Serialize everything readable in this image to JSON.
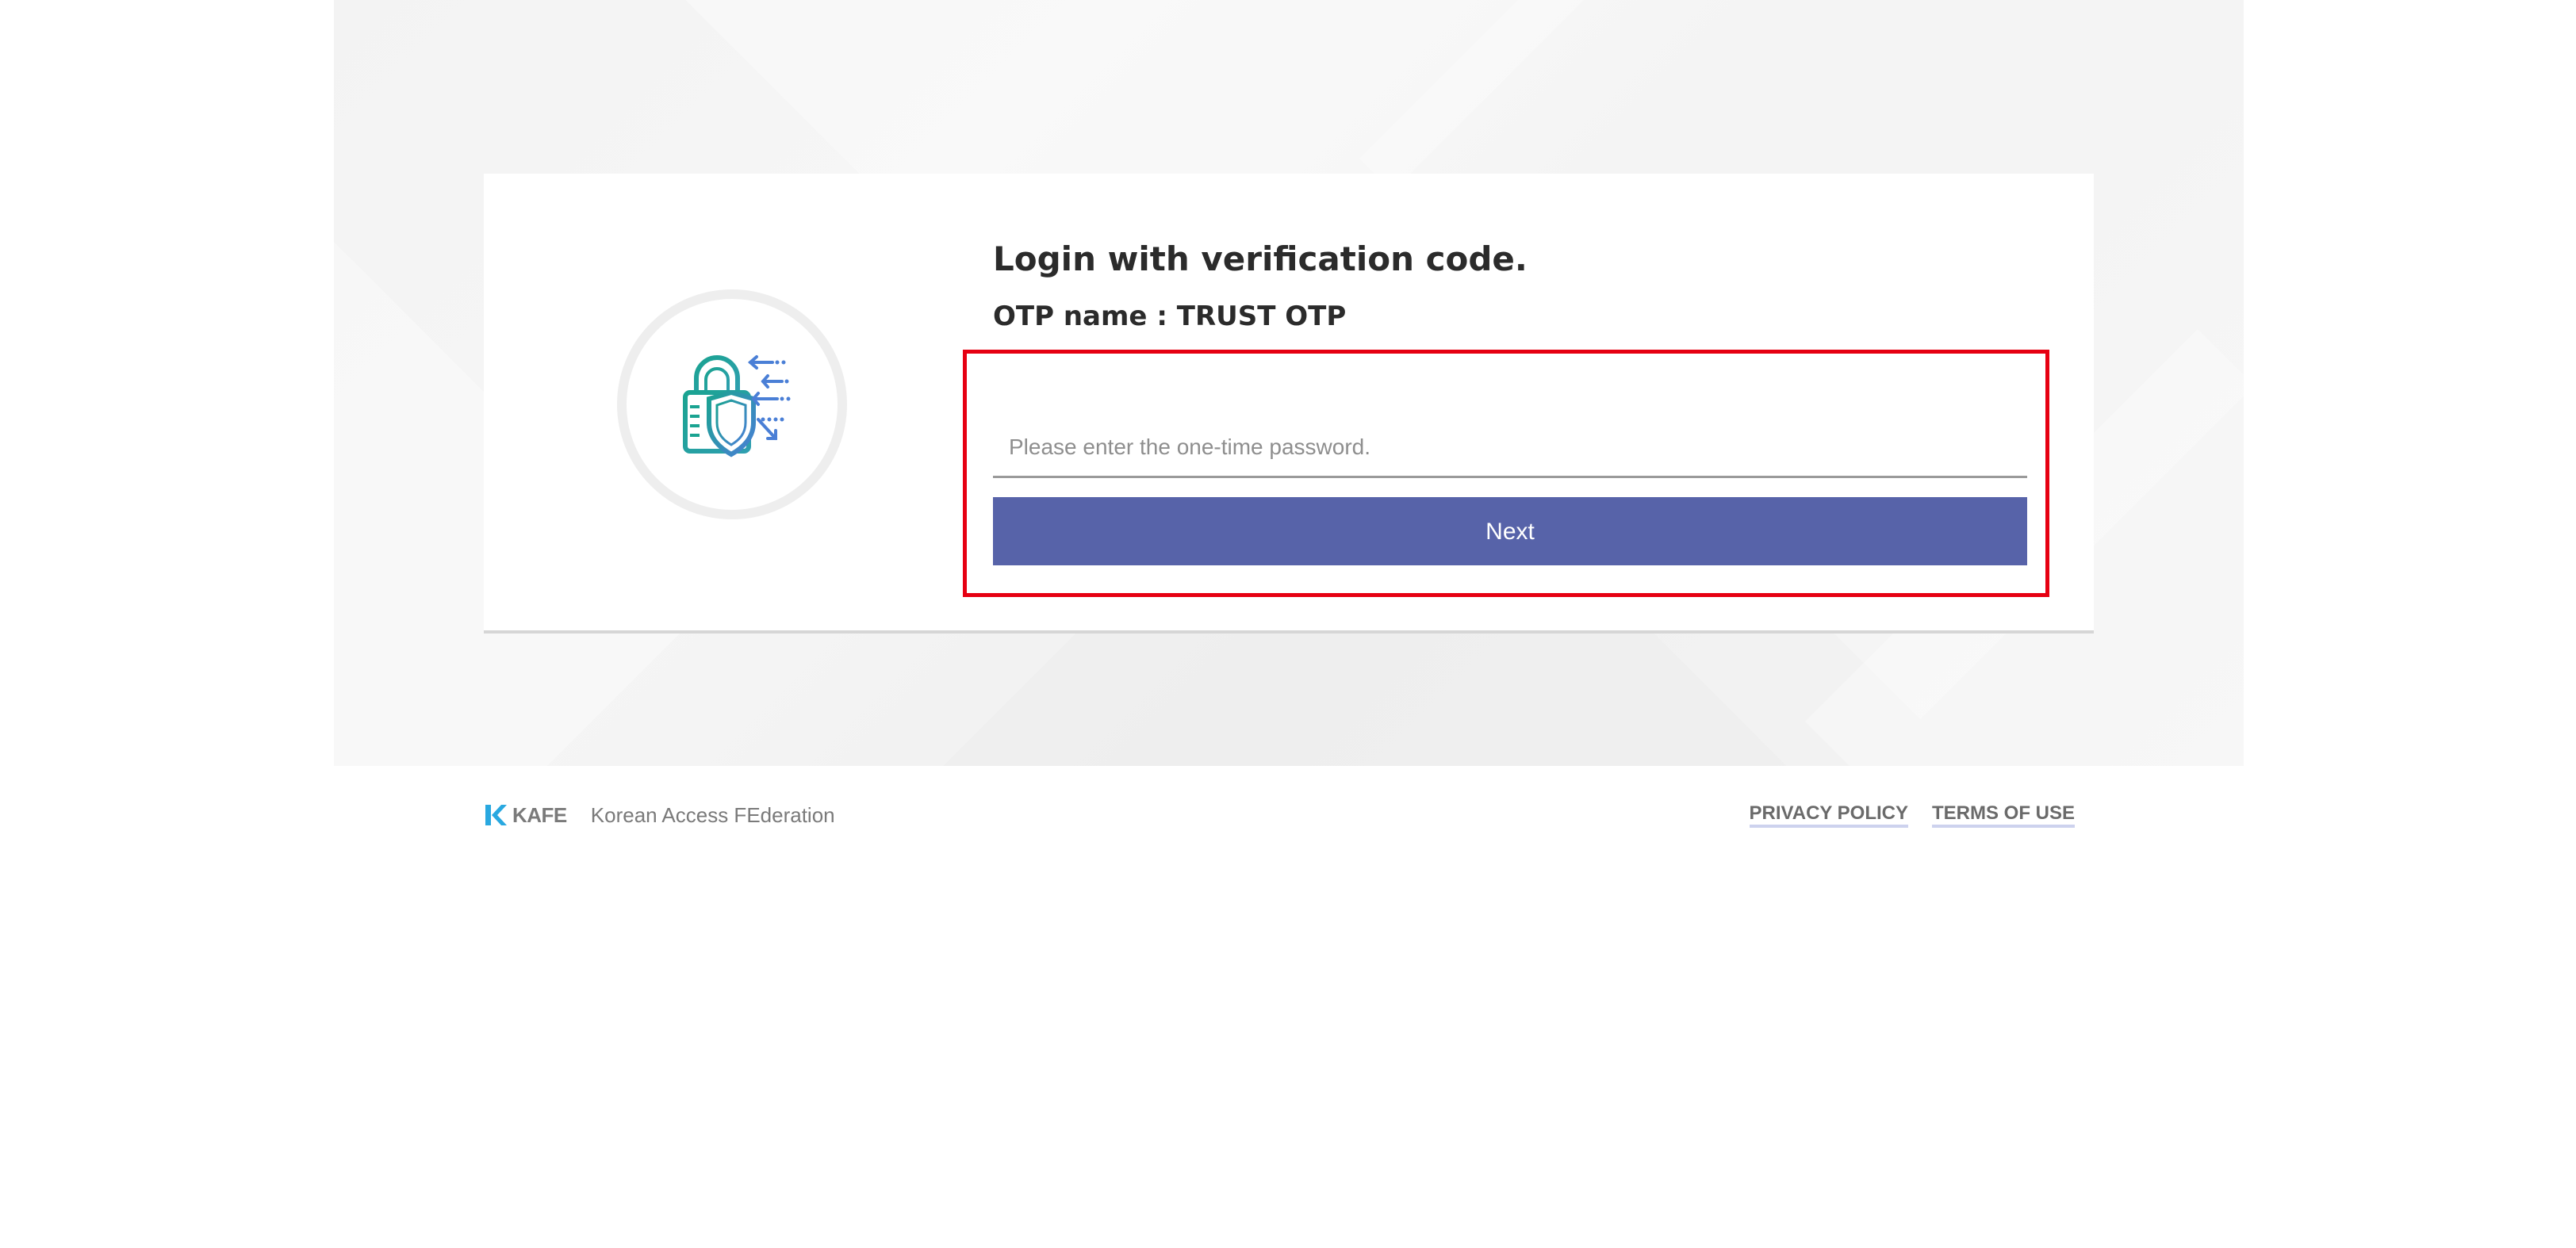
{
  "login": {
    "title": "Login with verification code.",
    "otp_name": "OTP name : TRUST OTP",
    "input_placeholder": "Please enter the one-time password.",
    "input_value": "",
    "next_label": "Next",
    "icon": "lock-shield-icon"
  },
  "colors": {
    "accent": "#5763a9",
    "highlight_border": "#e60012",
    "icon_green": "#1aa391",
    "icon_blue": "#4a7fd6"
  },
  "footer": {
    "logo_text": "KAFE",
    "brand_name": "Korean Access FEderation",
    "links": [
      {
        "label": "PRIVACY POLICY"
      },
      {
        "label": "TERMS OF USE"
      }
    ]
  }
}
